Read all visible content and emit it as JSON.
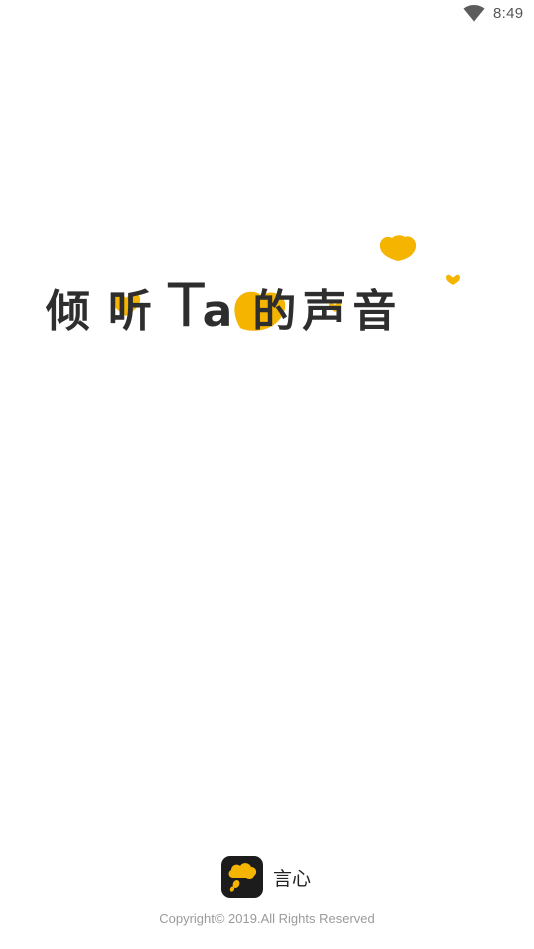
{
  "status_bar": {
    "time": "8:49",
    "wifi_icon": "wifi-icon"
  },
  "splash": {
    "slogan": {
      "chars": [
        "倾",
        "听",
        "T",
        "a",
        "的",
        "声",
        "音"
      ]
    },
    "accent_color": "#F5B400"
  },
  "footer": {
    "app_logo_icon": "yanxin-app-icon",
    "app_name": "言心",
    "copyright": "Copyright© 2019.All Rights Reserved"
  }
}
